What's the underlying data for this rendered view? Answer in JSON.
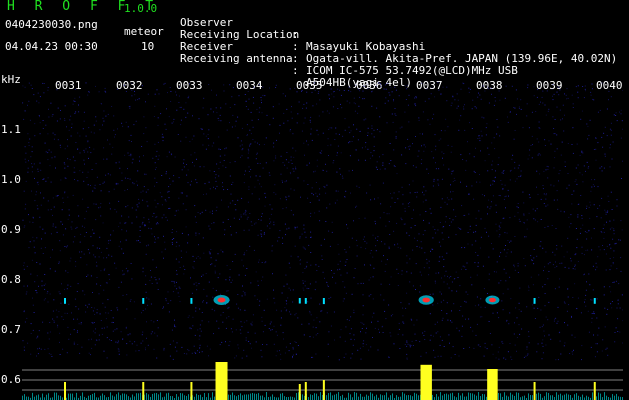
{
  "header": {
    "app_title": "H R O F F T",
    "version": "1.0.0",
    "filename": "0404230030.png",
    "meteor_label": "meteor",
    "datetime": "04.04.23 00:30",
    "meteor_count": "10"
  },
  "info": [
    {
      "key": "Observer",
      "value": "Masayuki Kobayashi"
    },
    {
      "key": "Receiving Location",
      "value": "Ogata-vill. Akita-Pref. JAPAN (139.96E, 40.02N)"
    },
    {
      "key": "Receiver",
      "value": "ICOM IC-575 53.7492(@LCD)MHz USB"
    },
    {
      "key": "Receiving antenna",
      "value": "A504HB(yagi 4el)"
    }
  ],
  "info_colon": ":",
  "spectrogram": {
    "unit": "kHz",
    "y_ticks": [
      "1.1",
      "1.0",
      "0.9",
      "0.8",
      "0.7",
      "0.6"
    ],
    "x_ticks": [
      "0031",
      "0032",
      "0033",
      "0034",
      "0035",
      "0036",
      "0037",
      "0038",
      "0039",
      "0040"
    ],
    "meteor_echoes": [
      {
        "time": "0031.0",
        "intensity": 0.3
      },
      {
        "time": "0032.3",
        "intensity": 0.3
      },
      {
        "time": "0033.1",
        "intensity": 0.3
      },
      {
        "time": "0033.6",
        "intensity": 1.0
      },
      {
        "time": "0034.9",
        "intensity": 0.25
      },
      {
        "time": "0035.0",
        "intensity": 0.3
      },
      {
        "time": "0035.3",
        "intensity": 0.35
      },
      {
        "time": "0037.0",
        "intensity": 0.9
      },
      {
        "time": "0038.1",
        "intensity": 0.75
      },
      {
        "time": "0038.8",
        "intensity": 0.3
      },
      {
        "time": "0039.8",
        "intensity": 0.3
      }
    ],
    "colors": {
      "background": "#000000",
      "noise": "#2020a0",
      "echo": "#00e0ff",
      "strong_echo": "#ff3030",
      "power_bar": "#ffff20",
      "baseline": "#00c0c0",
      "ref_line": "#a0a0a0"
    }
  }
}
